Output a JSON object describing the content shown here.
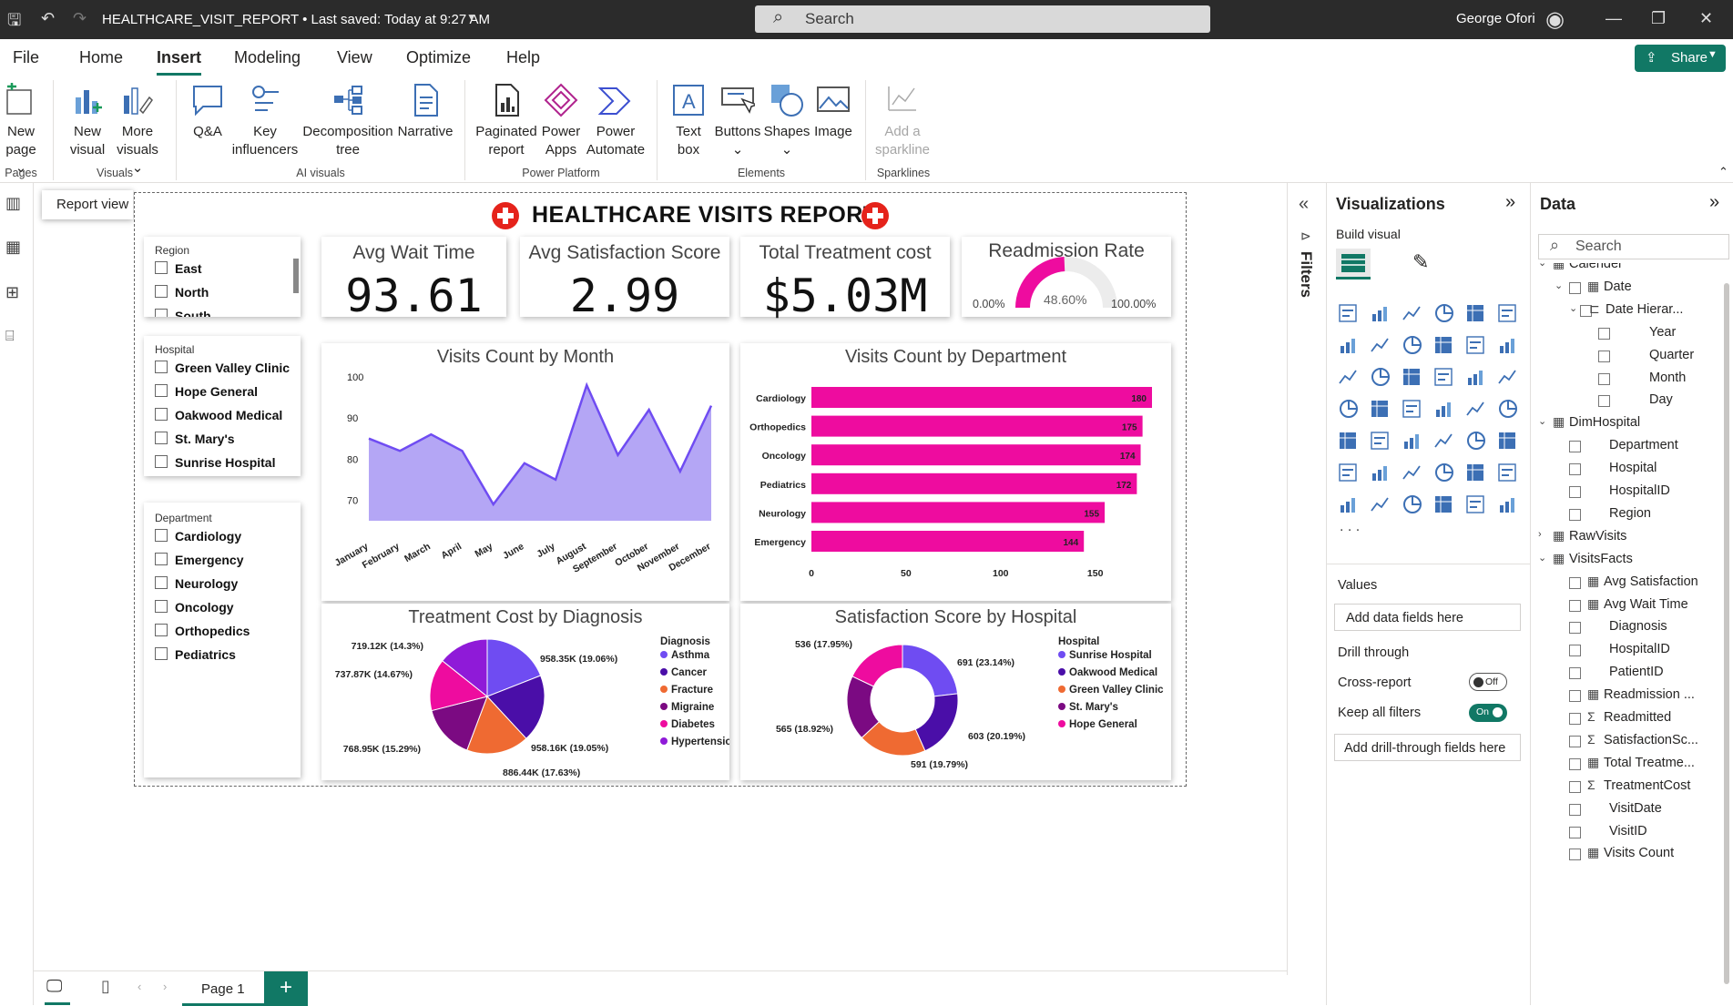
{
  "titlebar": {
    "title": "HEALTHCARE_VISIT_REPORT • Last saved: Today at 9:27 AM",
    "search_placeholder": "Search",
    "user": "George Ofori"
  },
  "menu": [
    "File",
    "Home",
    "Insert",
    "Modeling",
    "View",
    "Optimize",
    "Help"
  ],
  "share": "Share",
  "ribbon": {
    "buttons": [
      {
        "l1": "New",
        "l2": "page ⌄",
        "name": "new-page"
      },
      {
        "l1": "New",
        "l2": "visual",
        "name": "new-visual"
      },
      {
        "l1": "More",
        "l2": "visuals ⌄",
        "name": "more-visuals"
      },
      {
        "l1": "Q&A",
        "l2": "",
        "name": "qa"
      },
      {
        "l1": "Key",
        "l2": "influencers",
        "name": "key-influencers"
      },
      {
        "l1": "Decomposition",
        "l2": "tree",
        "name": "decomposition-tree"
      },
      {
        "l1": "Narrative",
        "l2": "",
        "name": "narrative"
      },
      {
        "l1": "Paginated",
        "l2": "report",
        "name": "paginated-report"
      },
      {
        "l1": "Power",
        "l2": "Apps",
        "name": "power-apps"
      },
      {
        "l1": "Power",
        "l2": "Automate",
        "name": "power-automate"
      },
      {
        "l1": "Text",
        "l2": "box",
        "name": "text-box"
      },
      {
        "l1": "Buttons",
        "l2": "⌄",
        "name": "buttons"
      },
      {
        "l1": "Shapes",
        "l2": "⌄",
        "name": "shapes"
      },
      {
        "l1": "Image",
        "l2": "",
        "name": "image"
      },
      {
        "l1": "Add a",
        "l2": "sparkline",
        "name": "add-sparkline"
      }
    ],
    "groups": [
      "Pages",
      "Visuals",
      "AI visuals",
      "Power Platform",
      "Elements",
      "Sparklines"
    ]
  },
  "tooltip": "Report view",
  "report": {
    "title": "HEALTHCARE VISITS REPORT",
    "kpis": [
      {
        "label": "Avg Wait Time",
        "value": "93.61"
      },
      {
        "label": "Avg Satisfaction Score",
        "value": "2.99"
      },
      {
        "label": "Total Treatment cost",
        "value": "$5.03M"
      }
    ],
    "gauge": {
      "label": "Readmission Rate",
      "value": "48.60%",
      "min": "0.00%",
      "max": "100.00%",
      "fraction": 0.486
    },
    "slicers": {
      "region": {
        "label": "Region",
        "items": [
          "East",
          "North",
          "South"
        ]
      },
      "hospital": {
        "label": "Hospital",
        "items": [
          "Green Valley Clinic",
          "Hope General",
          "Oakwood Medical",
          "St. Mary's",
          "Sunrise Hospital"
        ]
      },
      "department": {
        "label": "Department",
        "items": [
          "Cardiology",
          "Emergency",
          "Neurology",
          "Oncology",
          "Orthopedics",
          "Pediatrics"
        ]
      }
    }
  },
  "chart_data": [
    {
      "type": "area",
      "title": "Visits Count by Month",
      "categories": [
        "January",
        "February",
        "March",
        "April",
        "May",
        "June",
        "July",
        "August",
        "September",
        "October",
        "November",
        "December"
      ],
      "values": [
        85,
        82,
        86,
        82,
        69,
        79,
        75,
        98,
        81,
        92,
        77,
        93
      ],
      "ylim": [
        65,
        100
      ],
      "yticks": [
        70,
        80,
        90,
        100
      ],
      "color": "#6f4cf2"
    },
    {
      "type": "bar",
      "title": "Visits Count by Department",
      "categories": [
        "Cardiology",
        "Orthopedics",
        "Oncology",
        "Pediatrics",
        "Neurology",
        "Emergency"
      ],
      "values": [
        180,
        175,
        174,
        172,
        155,
        144
      ],
      "xlim": [
        0,
        180
      ],
      "xticks": [
        0,
        50,
        100,
        150
      ],
      "color": "#ee0c9f"
    },
    {
      "type": "pie",
      "title": "Treatment Cost by Diagnosis",
      "legend_title": "Diagnosis",
      "slices": [
        {
          "name": "Asthma",
          "value": 958.35,
          "label": "958.35K (19.06%)",
          "color": "#6f4cf2"
        },
        {
          "name": "Cancer",
          "value": 958.16,
          "label": "958.16K (19.05%)",
          "color": "#4a0ea8"
        },
        {
          "name": "Fracture",
          "value": 886.44,
          "label": "886.44K (17.63%)",
          "color": "#ef6a32"
        },
        {
          "name": "Migraine",
          "value": 768.95,
          "label": "768.95K (15.29%)",
          "color": "#7b0a82"
        },
        {
          "name": "Diabetes",
          "value": 737.87,
          "label": "737.87K (14.67%)",
          "color": "#ee0c9f"
        },
        {
          "name": "Hypertension",
          "value": 719.12,
          "label": "719.12K (14.3%)",
          "color": "#8f1ad8"
        }
      ]
    },
    {
      "type": "pie",
      "title": "Satisfaction Score by Hospital",
      "legend_title": "Hospital",
      "donut": true,
      "slices": [
        {
          "name": "Sunrise Hospital",
          "value": 691,
          "label": "691 (23.14%)",
          "color": "#6f4cf2"
        },
        {
          "name": "Oakwood Medical",
          "value": 603,
          "label": "603 (20.19%)",
          "color": "#4a0ea8"
        },
        {
          "name": "Green Valley Clinic",
          "value": 591,
          "label": "591 (19.79%)",
          "color": "#ef6a32"
        },
        {
          "name": "St. Mary's",
          "value": 565,
          "label": "565 (18.92%)",
          "color": "#7b0a82"
        },
        {
          "name": "Hope General",
          "value": 536,
          "label": "536 (17.95%)",
          "color": "#ee0c9f"
        }
      ]
    }
  ],
  "viz": {
    "title": "Visualizations",
    "build": "Build visual",
    "values": "Values",
    "add_fields": "Add data fields here",
    "drill": "Drill through",
    "cross": "Cross-report",
    "cross_state": "Off",
    "keep": "Keep all filters",
    "keep_state": "On",
    "add_drill": "Add drill-through fields here"
  },
  "filters": "Filters",
  "data": {
    "title": "Data",
    "search": "Search",
    "tree": [
      {
        "t": "Calender",
        "lvl": 0,
        "kind": "table",
        "exp": "v"
      },
      {
        "t": "Date",
        "lvl": 1,
        "kind": "cal",
        "exp": "v",
        "cb": true
      },
      {
        "t": "Date Hierar...",
        "lvl": 2,
        "kind": "hier",
        "exp": "v",
        "cb": true
      },
      {
        "t": "Year",
        "lvl": 3,
        "cb": true
      },
      {
        "t": "Quarter",
        "lvl": 3,
        "cb": true
      },
      {
        "t": "Month",
        "lvl": 3,
        "cb": true
      },
      {
        "t": "Day",
        "lvl": 3,
        "cb": true
      },
      {
        "t": "DimHospital",
        "lvl": 0,
        "kind": "table",
        "exp": "v"
      },
      {
        "t": "Department",
        "lvl": 1,
        "cb": true
      },
      {
        "t": "Hospital",
        "lvl": 1,
        "cb": true
      },
      {
        "t": "HospitalID",
        "lvl": 1,
        "cb": true
      },
      {
        "t": "Region",
        "lvl": 1,
        "cb": true
      },
      {
        "t": "RawVisits",
        "lvl": 0,
        "kind": "table",
        "exp": ">"
      },
      {
        "t": "VisitsFacts",
        "lvl": 0,
        "kind": "table",
        "exp": "v"
      },
      {
        "t": "Avg Satisfaction",
        "lvl": 1,
        "kind": "calc",
        "cb": true
      },
      {
        "t": "Avg Wait Time",
        "lvl": 1,
        "kind": "calc",
        "cb": true
      },
      {
        "t": "Diagnosis",
        "lvl": 1,
        "cb": true
      },
      {
        "t": "HospitalID",
        "lvl": 1,
        "cb": true
      },
      {
        "t": "PatientID",
        "lvl": 1,
        "cb": true
      },
      {
        "t": "Readmission ...",
        "lvl": 1,
        "kind": "calc",
        "cb": true
      },
      {
        "t": "Readmitted",
        "lvl": 1,
        "kind": "sum",
        "cb": true
      },
      {
        "t": "SatisfactionSc...",
        "lvl": 1,
        "kind": "sum",
        "cb": true
      },
      {
        "t": "Total Treatme...",
        "lvl": 1,
        "kind": "calc",
        "cb": true
      },
      {
        "t": "TreatmentCost",
        "lvl": 1,
        "kind": "sum",
        "cb": true
      },
      {
        "t": "VisitDate",
        "lvl": 1,
        "cb": true
      },
      {
        "t": "VisitID",
        "lvl": 1,
        "cb": true
      },
      {
        "t": "Visits Count",
        "lvl": 1,
        "kind": "calc",
        "cb": true
      }
    ]
  },
  "bottom": {
    "page": "Page 1"
  }
}
